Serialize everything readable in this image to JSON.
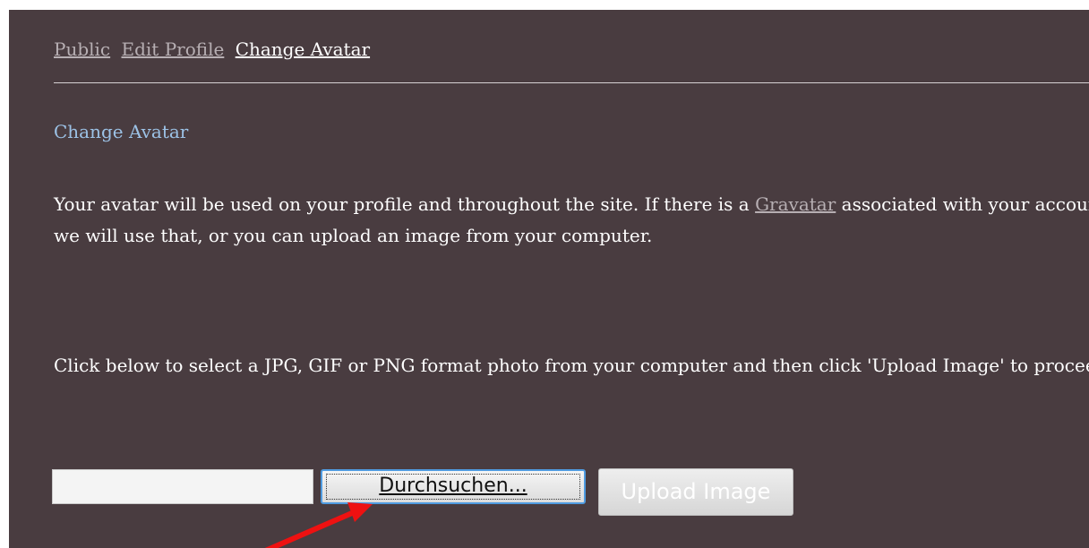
{
  "tabs": {
    "public": "Public",
    "edit_profile": "Edit Profile",
    "change_avatar": "Change Avatar"
  },
  "section_title": "Change Avatar",
  "paragraph1": {
    "before_link": "Your avatar will be used on your profile and throughout the site. If there is a ",
    "link": "Gravatar",
    "after_link": " associated with your account email we will use that, or you can upload an image from your computer."
  },
  "paragraph2": "Click below to select a JPG, GIF or PNG format photo from your computer and then click 'Upload Image' to proceed.",
  "file_input": {
    "value": "",
    "browse_label": "Durchsuchen..."
  },
  "upload_button_label": "Upload Image",
  "colors": {
    "panel_background": "#493c40",
    "section_title": "#9cc2e6",
    "inactive_link": "#b7afb3",
    "annotation_arrow": "#ee1111"
  },
  "annotation": {
    "icon": "red-arrow-icon"
  }
}
